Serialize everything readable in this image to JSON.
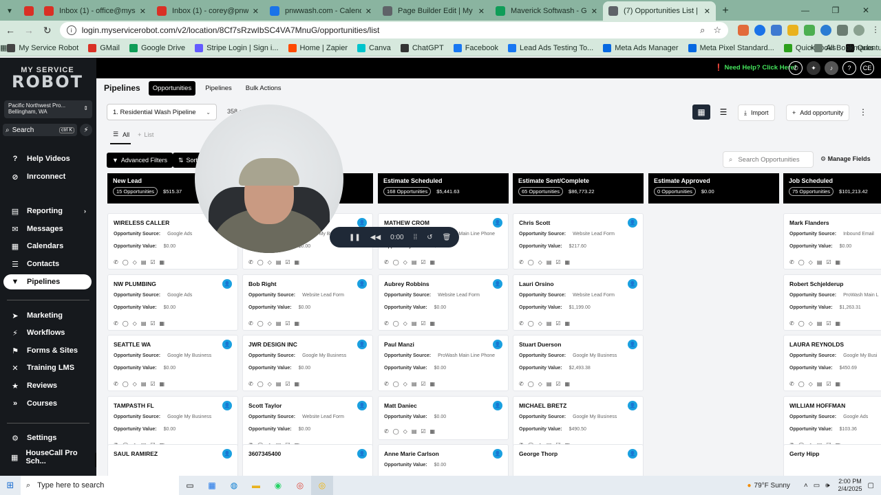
{
  "browser": {
    "tabs": [
      {
        "title": "",
        "color": "#d93025"
      },
      {
        "title": "Inbox (1) - office@myservicerobot",
        "color": "#d93025"
      },
      {
        "title": "Inbox (1) - corey@pnwwash.com",
        "color": "#d93025"
      },
      {
        "title": "pnwwash.com - Calendar - Febr",
        "color": "#1a73e8"
      },
      {
        "title": "Page Builder Edit | My Service R",
        "color": "#5f6368"
      },
      {
        "title": "Maverick Softwash - Google Dr",
        "color": "#0f9d58"
      },
      {
        "title": "(7) Opportunities List | Pacific",
        "color": "#5f6368"
      }
    ],
    "url": "login.myservicerobot.com/v2/location/8Cf7sRzwIbSC4VA7MnuG/opportunities/list",
    "bookmarks": [
      {
        "label": "My Service Robot",
        "color": "#444"
      },
      {
        "label": "GMail",
        "color": "#d93025"
      },
      {
        "label": "Google Drive",
        "color": "#0f9d58"
      },
      {
        "label": "Stripe Login | Sign i...",
        "color": "#635bff"
      },
      {
        "label": "Home | Zapier",
        "color": "#ff4a00"
      },
      {
        "label": "Canva",
        "color": "#00c4cc"
      },
      {
        "label": "ChatGPT",
        "color": "#333"
      },
      {
        "label": "Facebook",
        "color": "#1877f2"
      },
      {
        "label": "Lead Ads Testing To...",
        "color": "#1877f2"
      },
      {
        "label": "Meta Ads Manager",
        "color": "#0668e1"
      },
      {
        "label": "Meta Pixel Standard...",
        "color": "#0668e1"
      },
      {
        "label": "QuickBooks",
        "color": "#2ca01c"
      },
      {
        "label": "Quantum Growth",
        "color": "#111"
      }
    ],
    "all_bookmarks": "All Bookmarks"
  },
  "header": {
    "help": "Need Help? Click Here!",
    "avatar": "CE"
  },
  "sidebar": {
    "logo_top": "MY SERVICE",
    "logo_bottom": "ROBOT",
    "location_name": "Pacific Northwest Pro...",
    "location_city": "Bellingham, WA",
    "search_label": "Search",
    "search_kbd": "ctrl K",
    "items": [
      {
        "label": "Help Videos",
        "icon": "?"
      },
      {
        "label": "Inrconnect",
        "icon": "⊘"
      },
      {
        "label": "Reporting",
        "icon": "▤"
      },
      {
        "label": "Messages",
        "icon": "✉"
      },
      {
        "label": "Calendars",
        "icon": "▦"
      },
      {
        "label": "Contacts",
        "icon": "☰"
      },
      {
        "label": "Pipelines",
        "icon": "▼"
      },
      {
        "label": "Marketing",
        "icon": "➤"
      },
      {
        "label": "Workflows",
        "icon": "⚡"
      },
      {
        "label": "Forms & Sites",
        "icon": "⚑"
      },
      {
        "label": "Training LMS",
        "icon": "✕"
      },
      {
        "label": "Reviews",
        "icon": "★"
      },
      {
        "label": "Courses",
        "icon": "»"
      },
      {
        "label": "Settings",
        "icon": "⚙"
      },
      {
        "label": "HouseCall Pro Sch...",
        "icon": "▦"
      }
    ]
  },
  "main": {
    "title": "Pipelines",
    "subnav": [
      "Opportunities",
      "Pipelines",
      "Bulk Actions"
    ],
    "pipeline_select": "1. Residential Wash Pipeline",
    "opp_count": "358 o",
    "import_label": "Import",
    "add_label": "Add opportunity",
    "tab_all": "All",
    "tab_list": "List",
    "advanced_filters": "Advanced Filters",
    "sort": "Sort",
    "search_placeholder": "Search Opportunities",
    "manage_fields": "Manage Fields",
    "source_label": "Opportunity Source:",
    "value_label": "Opportunity Value:"
  },
  "board": {
    "columns": [
      {
        "title": "New Lead",
        "count": "15 Opportunities",
        "total": "$515.37",
        "cards": [
          {
            "name": "WIRELESS CALLER",
            "source": "Google Ads",
            "value": "$0.00"
          },
          {
            "name": "NW PLUMBING",
            "source": "Google Ads",
            "value": "$0.00"
          },
          {
            "name": "SEATTLE WA",
            "source": "Google My Business",
            "value": "$0.00"
          },
          {
            "name": "TAMPASTH FL",
            "source": "Google My Business",
            "value": "$0.00"
          },
          {
            "name": "SAUL RAMIREZ",
            "source": "",
            "value": ""
          }
        ]
      },
      {
        "title": "",
        "count": "",
        "total": "",
        "cards": [
          {
            "name": "",
            "source": "Google My Bu",
            "value": "$0.00"
          },
          {
            "name": "Bob Right",
            "source": "Website Lead Form",
            "value": "$0.00"
          },
          {
            "name": "JWR DESIGN INC",
            "source": "Google My Business",
            "value": "$0.00"
          },
          {
            "name": "Scott Taylor",
            "source": "Website Lead Form",
            "value": "$0.00"
          },
          {
            "name": "3607345400",
            "source": "",
            "value": ""
          }
        ]
      },
      {
        "title": "Estimate Scheduled",
        "count": "168 Opportunities",
        "total": "$5,441.63",
        "cards": [
          {
            "name": "MATHEW CROM",
            "source": "ProWash Main Line Phone",
            "value": "$0.00"
          },
          {
            "name": "Aubrey Robbins",
            "source": "Website Lead Form",
            "value": "$0.00"
          },
          {
            "name": "Paul Manzi",
            "source": "ProWash Main Line Phone",
            "value": "$0.00"
          },
          {
            "name": "Matt Daniec",
            "source": "",
            "value": "$0.00"
          },
          {
            "name": "Anne Marie Carlson",
            "source": "",
            "value": "$0.00"
          }
        ]
      },
      {
        "title": "Estimate Sent/Complete",
        "count": "65 Opportunities",
        "total": "$86,773.22",
        "cards": [
          {
            "name": "Chris Scott",
            "source": "Website Lead Form",
            "value": "$217.60"
          },
          {
            "name": "Lauri Orsino",
            "source": "Website Lead Form",
            "value": "$1,199.00"
          },
          {
            "name": "Stuart Duerson",
            "source": "Google My Business",
            "value": "$2,493.38"
          },
          {
            "name": "MICHAEL BRETZ",
            "source": "Google My Business",
            "value": "$490.50"
          },
          {
            "name": "George Thorp",
            "source": "",
            "value": ""
          }
        ]
      },
      {
        "title": "Estimate Approved",
        "count": "0 Opportunities",
        "total": "$0.00",
        "cards": []
      },
      {
        "title": "Job Scheduled",
        "count": "75 Opportunities",
        "total": "$101,213.42",
        "cards": [
          {
            "name": "Mark Flanders",
            "source": "Inbound Email",
            "value": "$0.00"
          },
          {
            "name": "Robert Schjelderup",
            "source": "ProWash Main L",
            "value": "$1,263.31"
          },
          {
            "name": "LAURA REYNOLDS",
            "source": "Google My Busi",
            "value": "$450.69"
          },
          {
            "name": "WILLIAM HOFFMAN",
            "source": "Google Ads",
            "value": "$103.36"
          },
          {
            "name": "Gerty Hipp",
            "source": "",
            "value": ""
          }
        ]
      }
    ]
  },
  "recording": {
    "time": "0:00"
  },
  "taskbar": {
    "search": "Type here to search",
    "weather": "79°F  Sunny",
    "time": "2:00 PM",
    "date": "2/4/2025"
  }
}
